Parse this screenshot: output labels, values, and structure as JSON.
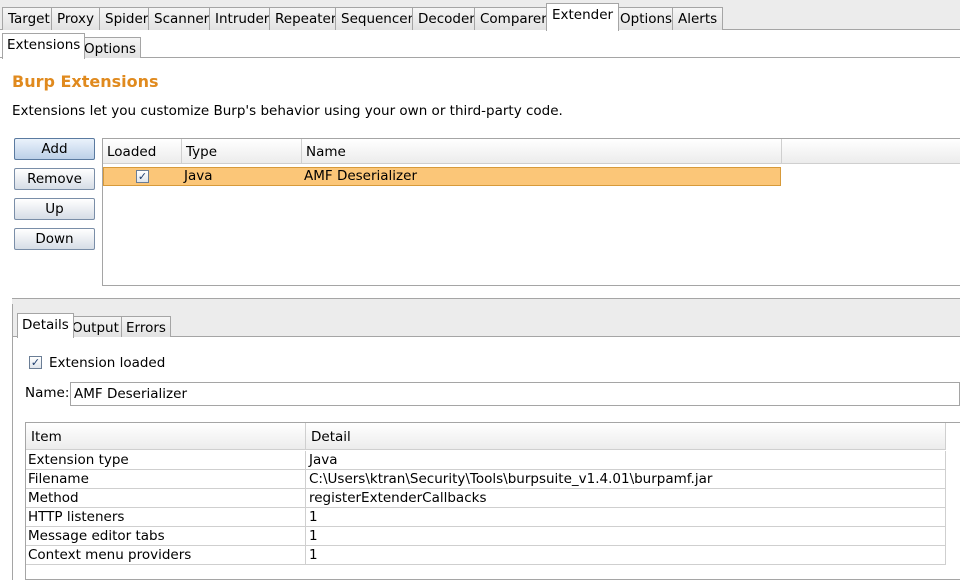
{
  "main_tabs": [
    {
      "label": "Target"
    },
    {
      "label": "Proxy"
    },
    {
      "label": "Spider"
    },
    {
      "label": "Scanner"
    },
    {
      "label": "Intruder"
    },
    {
      "label": "Repeater"
    },
    {
      "label": "Sequencer"
    },
    {
      "label": "Decoder"
    },
    {
      "label": "Comparer"
    },
    {
      "label": "Extender",
      "active": true
    },
    {
      "label": "Options"
    },
    {
      "label": "Alerts"
    }
  ],
  "sub_tabs": [
    {
      "label": "Extensions",
      "active": true
    },
    {
      "label": "Options"
    }
  ],
  "page": {
    "title": "Burp Extensions",
    "description": "Extensions let you customize Burp's behavior using your own or third-party code."
  },
  "buttons": {
    "add": "Add",
    "remove": "Remove",
    "up": "Up",
    "down": "Down"
  },
  "extensions_table": {
    "headers": [
      "Loaded",
      "Type",
      "Name"
    ],
    "rows": [
      {
        "loaded": true,
        "type": "Java",
        "name": "AMF Deserializer",
        "selected": true
      }
    ]
  },
  "detail_tabs": [
    {
      "label": "Details",
      "active": true
    },
    {
      "label": "Output"
    },
    {
      "label": "Errors"
    }
  ],
  "details": {
    "extension_loaded_label": "Extension loaded",
    "extension_loaded": true,
    "name_label": "Name:",
    "name_value": "AMF Deserializer",
    "table": {
      "headers": [
        "Item",
        "Detail"
      ],
      "rows": [
        {
          "item": "Extension type",
          "detail": "Java"
        },
        {
          "item": "Filename",
          "detail": "C:\\Users\\ktran\\Security\\Tools\\burpsuite_v1.4.01\\burpamf.jar"
        },
        {
          "item": "Method",
          "detail": "registerExtenderCallbacks"
        },
        {
          "item": "HTTP listeners",
          "detail": "1"
        },
        {
          "item": "Message editor tabs",
          "detail": "1"
        },
        {
          "item": "Context menu providers",
          "detail": "1"
        }
      ]
    }
  },
  "colors": {
    "heading": "#e08a1e",
    "selected_row": "#fbc678"
  },
  "icons": {
    "checkbox_checked": "checkmark-icon"
  }
}
